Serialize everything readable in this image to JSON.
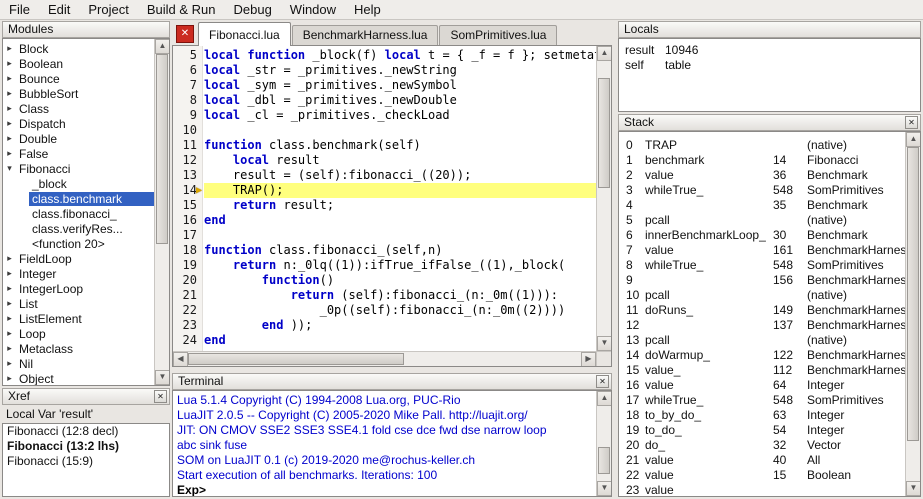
{
  "colors": {
    "keyword": "#0000c8",
    "terminal_info": "#0000cd",
    "current_line_bg": "#ffff7e",
    "selection_bg": "#3261c2",
    "close_button_bg": "#cb2b20",
    "exec_arrow": "#dca700"
  },
  "glyphs": {
    "close": "✕",
    "scroll_up": "▲",
    "scroll_down": "▼",
    "scroll_left": "◀",
    "scroll_right": "▶",
    "tree_collapsed": "▸",
    "tree_expanded": "▾",
    "exec_arrow": "▶"
  },
  "menu": {
    "items": [
      "File",
      "Edit",
      "Project",
      "Build & Run",
      "Debug",
      "Window",
      "Help"
    ]
  },
  "modules": {
    "title": "Modules",
    "items": [
      {
        "label": "Block",
        "state": "collapsed",
        "level": 0
      },
      {
        "label": "Boolean",
        "state": "collapsed",
        "level": 0
      },
      {
        "label": "Bounce",
        "state": "collapsed",
        "level": 0
      },
      {
        "label": "BubbleSort",
        "state": "collapsed",
        "level": 0
      },
      {
        "label": "Class",
        "state": "collapsed",
        "level": 0
      },
      {
        "label": "Dispatch",
        "state": "collapsed",
        "level": 0
      },
      {
        "label": "Double",
        "state": "collapsed",
        "level": 0
      },
      {
        "label": "False",
        "state": "collapsed",
        "level": 0
      },
      {
        "label": "Fibonacci",
        "state": "expanded",
        "level": 0
      },
      {
        "label": "_block",
        "state": "leaf",
        "level": 1
      },
      {
        "label": "class.benchmark",
        "state": "leaf",
        "level": 1,
        "selected": true
      },
      {
        "label": "class.fibonacci_",
        "state": "leaf",
        "level": 1
      },
      {
        "label": "class.verifyRes...",
        "state": "leaf",
        "level": 1
      },
      {
        "label": "<function 20>",
        "state": "leaf",
        "level": 1
      },
      {
        "label": "FieldLoop",
        "state": "collapsed",
        "level": 0
      },
      {
        "label": "Integer",
        "state": "collapsed",
        "level": 0
      },
      {
        "label": "IntegerLoop",
        "state": "collapsed",
        "level": 0
      },
      {
        "label": "List",
        "state": "collapsed",
        "level": 0
      },
      {
        "label": "ListElement",
        "state": "collapsed",
        "level": 0
      },
      {
        "label": "Loop",
        "state": "collapsed",
        "level": 0
      },
      {
        "label": "Metaclass",
        "state": "collapsed",
        "level": 0
      },
      {
        "label": "Nil",
        "state": "collapsed",
        "level": 0
      },
      {
        "label": "Object",
        "state": "collapsed",
        "level": 0
      }
    ]
  },
  "xref": {
    "title": "Xref",
    "context": "Local Var 'result'",
    "items": [
      {
        "label": "Fibonacci (12:8 decl)",
        "bold": false
      },
      {
        "label": "Fibonacci (13:2 lhs)",
        "bold": true
      },
      {
        "label": "Fibonacci (15:9)",
        "bold": false
      }
    ]
  },
  "tabs": [
    {
      "label": "Fibonacci.lua",
      "active": true
    },
    {
      "label": "BenchmarkHarness.lua",
      "active": false
    },
    {
      "label": "SomPrimitives.lua",
      "active": false
    }
  ],
  "editor": {
    "first_line": 5,
    "current_line": 14,
    "lines": [
      "local function _block(f) local t = { _f = f }; setmetat",
      "local _str = _primitives._newString",
      "local _sym = _primitives._newSymbol",
      "local _dbl = _primitives._newDouble",
      "local _cl = _primitives._checkLoad",
      "",
      "function class.benchmark(self)",
      "    local result",
      "    result = (self):fibonacci_((20));",
      "    TRAP();",
      "    return result;",
      "end",
      "",
      "function class.fibonacci_(self,n)",
      "    return n:_0lq((1)):ifTrue_ifFalse_((1),_block(",
      "        function()",
      "            return (self):fibonacci_(n:_0m((1))):",
      "                _0p((self):fibonacci_(n:_0m((2))))",
      "        end ));",
      "end"
    ]
  },
  "terminal": {
    "title": "Terminal",
    "lines": [
      {
        "text": "Lua 5.1.4 Copyright (C) 1994-2008 Lua.org, PUC-Rio",
        "style": "info"
      },
      {
        "text": "LuaJIT 2.0.5 -- Copyright (C) 2005-2020 Mike Pall. http://luajit.org/",
        "style": "info"
      },
      {
        "text": "JIT: ON CMOV SSE2 SSE3 SSE4.1 fold cse dce fwd dse narrow loop",
        "style": "info"
      },
      {
        "text": "abc sink fuse",
        "style": "info"
      },
      {
        "text": "SOM on LuaJIT 0.1 (c) 2019-2020 me@rochus-keller.ch",
        "style": "info"
      },
      {
        "text": "Start execution of all benchmarks. Iterations: 100",
        "style": "info"
      },
      {
        "text": "Exp>",
        "style": "prompt"
      }
    ]
  },
  "locals": {
    "title": "Locals",
    "rows": [
      {
        "name": "result",
        "value": "10946"
      },
      {
        "name": "self",
        "value": "table"
      }
    ]
  },
  "stack": {
    "title": "Stack",
    "rows": [
      {
        "level": "0",
        "func": "TRAP",
        "line": "",
        "source": "(native)"
      },
      {
        "level": "1",
        "func": "benchmark",
        "line": "14",
        "source": "Fibonacci"
      },
      {
        "level": "2",
        "func": "value",
        "line": "36",
        "source": "Benchmark"
      },
      {
        "level": "3",
        "func": "whileTrue_",
        "line": "548",
        "source": "SomPrimitives"
      },
      {
        "level": "4",
        "func": "",
        "line": "35",
        "source": "Benchmark"
      },
      {
        "level": "5",
        "func": "pcall",
        "line": "",
        "source": "(native)"
      },
      {
        "level": "6",
        "func": "innerBenchmarkLoop_",
        "line": "30",
        "source": "Benchmark"
      },
      {
        "level": "7",
        "func": "value",
        "line": "161",
        "source": "BenchmarkHarness"
      },
      {
        "level": "8",
        "func": "whileTrue_",
        "line": "548",
        "source": "SomPrimitives"
      },
      {
        "level": "9",
        "func": "",
        "line": "156",
        "source": "BenchmarkHarness"
      },
      {
        "level": "10",
        "func": "pcall",
        "line": "",
        "source": "(native)"
      },
      {
        "level": "11",
        "func": "doRuns_",
        "line": "149",
        "source": "BenchmarkHarness"
      },
      {
        "level": "12",
        "func": "",
        "line": "137",
        "source": "BenchmarkHarness"
      },
      {
        "level": "13",
        "func": "pcall",
        "line": "",
        "source": "(native)"
      },
      {
        "level": "14",
        "func": "doWarmup_",
        "line": "122",
        "source": "BenchmarkHarness"
      },
      {
        "level": "15",
        "func": "value_",
        "line": "112",
        "source": "BenchmarkHarness"
      },
      {
        "level": "16",
        "func": "value",
        "line": "64",
        "source": "Integer"
      },
      {
        "level": "17",
        "func": "whileTrue_",
        "line": "548",
        "source": "SomPrimitives"
      },
      {
        "level": "18",
        "func": "to_by_do_",
        "line": "63",
        "source": "Integer"
      },
      {
        "level": "19",
        "func": "to_do_",
        "line": "54",
        "source": "Integer"
      },
      {
        "level": "20",
        "func": "do_",
        "line": "32",
        "source": "Vector"
      },
      {
        "level": "21",
        "func": "value",
        "line": "40",
        "source": "All"
      },
      {
        "level": "22",
        "func": "value",
        "line": "15",
        "source": "Boolean"
      },
      {
        "level": "23",
        "func": "value",
        "line": "",
        "source": ""
      }
    ]
  }
}
